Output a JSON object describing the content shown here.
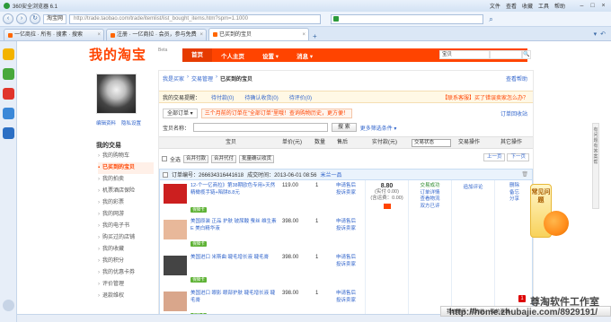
{
  "browser": {
    "title": "360安全浏览器 6.1",
    "menus": [
      "文件",
      "查看",
      "收藏",
      "工具",
      "帮助"
    ],
    "shop_button": "淘宝网",
    "url": "http://trade.taobao.com/trade/itemlist/list_bought_items.htm?spm=1.1000",
    "tabs": [
      {
        "label": "一亿商拉 · 所有 · 搜素 · 搜索",
        "active": false
      },
      {
        "label": "注册 · 一亿商拉 · 会员，参与免费",
        "active": false
      },
      {
        "label": "已买到的宝贝",
        "active": true
      }
    ]
  },
  "taobao": {
    "logo": "我的淘宝",
    "beta": "Beta",
    "nav": [
      "首页",
      "个人主页",
      "设置 ▾",
      "消息 ▾"
    ],
    "search_scope": "宝贝",
    "search_button": "🔍",
    "avatar_links": [
      "编辑资料",
      "隐私设置"
    ],
    "section_title": "我的交易",
    "menu": [
      {
        "label": "我的购物车",
        "active": false
      },
      {
        "label": "已买到的宝贝",
        "active": true
      },
      {
        "label": "我的拍卖",
        "active": false
      },
      {
        "label": "机票酒店保险",
        "active": false
      },
      {
        "label": "我的彩票",
        "active": false
      },
      {
        "label": "我的网游",
        "active": false
      },
      {
        "label": "我的电子书",
        "active": false
      },
      {
        "label": "购买过的店铺",
        "active": false
      },
      {
        "label": "我的收藏",
        "active": false
      },
      {
        "label": "我的积分",
        "active": false
      },
      {
        "label": "我的优惠卡券",
        "active": false
      },
      {
        "label": "评价管理",
        "active": false
      },
      {
        "label": "退款维权",
        "active": false
      }
    ],
    "breadcrumb": [
      "我是买家",
      "交易管理",
      "已买到的宝贝"
    ],
    "help": "查看帮助",
    "reminder_label": "我的交易提醒：",
    "reminders": [
      "待付款(0)",
      "待确认收货(0)",
      "待评价(0)"
    ],
    "reminder_warn": "【联系客服】买了错误卖家怎么办？",
    "all_orders": "全部订单 ▾",
    "notice": "三个月前的订单在\"全部订单\"里哦！查询购物历史，更方便！",
    "recycle": "订单回收站",
    "search_label": "宝贝名称：",
    "search_btn": "搜 索",
    "more_filters": "更多筛选条件 ▾",
    "columns": {
      "item": "宝贝",
      "unit_price": "单价(元)",
      "qty": "数量",
      "after_sale": "售后",
      "paid": "实付款(元)",
      "status_select": "交易状态",
      "ops": "交易操作",
      "other": "其它操作"
    },
    "bulk": {
      "all": "全选",
      "merge_pay": "合并付款",
      "merge_proxy": "合并代付",
      "batch_confirm": "批量确认收货"
    },
    "pager": [
      "上一页",
      "下一页"
    ],
    "order": {
      "number_label": "订单编号：266634316441618",
      "time": "成交时间：2013-06-01 08:56",
      "seller": "米兰一品",
      "delete": "🗑"
    },
    "items": [
      {
        "name": "12-个一亿商拉》第38期欧色专用+天然精橄榄手链+陷阱8.8元",
        "price": "119.00",
        "qty": "1",
        "svc": [
          "申请售后",
          "投诉卖家"
        ],
        "thumb_color": "#cc1f1f"
      },
      {
        "name": "美国原装 正品 护肤 玻尿酸 蚕丝 维生素E 美白精华液",
        "price": "398.00",
        "qty": "1",
        "svc": [
          "申请售后",
          "投诉卖家"
        ],
        "thumb_color": "#e8b89a"
      },
      {
        "name": "美国进口 米斯曲 睫毛增长液 睫毛膏",
        "price": "398.00",
        "qty": "1",
        "svc": [
          "申请售后",
          "投诉卖家"
        ],
        "thumb_color": "#444444"
      },
      {
        "name": "美国进口 眼影 眼部护肤 睫毛增长液 睫毛膏",
        "price": "398.00",
        "qty": "1",
        "svc": [
          "申请售后",
          "投诉卖家"
        ],
        "thumb_color": "#d9a68b"
      }
    ],
    "badge": "保障卡",
    "total": "8.80",
    "total_sub": "(实付 0.00)",
    "total_sub2": "(含运费：0.00)",
    "status": [
      "交易成功",
      "订单详情",
      "查看物流",
      "双方已评"
    ],
    "op": "追加评论",
    "other": [
      "删除",
      "备忘",
      "分享"
    ]
  },
  "side": {
    "faq_tab": "有问题 有答案帮",
    "faq": "常见问题",
    "bottom": [
      "我的聊天",
      "我的站·",
      "我的商城·"
    ],
    "notif_count": "1",
    "watermark1": "尊淘软件工作室",
    "watermark2": "http://home.zhubajie.com/8929191/"
  }
}
